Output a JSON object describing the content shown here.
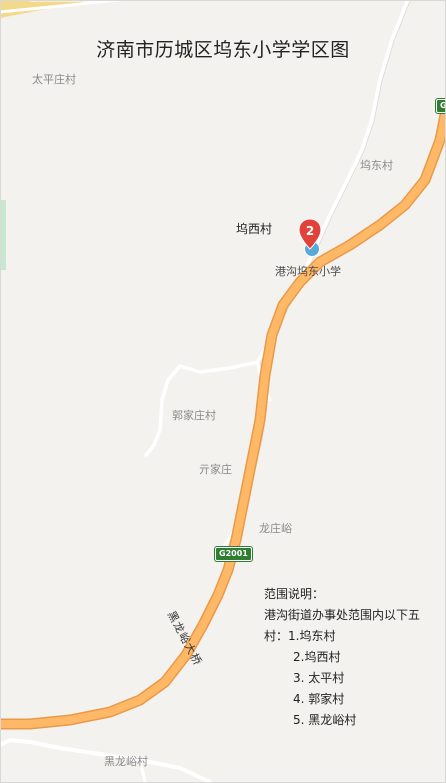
{
  "title": "济南市历城区坞东小学学区图",
  "places": {
    "taiping": "太平庄村",
    "wudong": "坞东村",
    "wuxi": "坞西村",
    "guojia": "郭家庄村",
    "kaijia": "亓家庄",
    "longzhuang": "龙庄峪",
    "heilongyu": "黑龙峪村"
  },
  "school": {
    "label": "港沟坞东小学",
    "marker_number": "2"
  },
  "roads": {
    "highway_top": "G",
    "highway_mid": "G2001",
    "bridge": "黑龙峪大桥"
  },
  "legend": {
    "heading": "范围说明：",
    "line1": "港沟街道办事处范围内以下五",
    "line2": "村：1.坞东村",
    "items": [
      "2.坞西村",
      "3. 太平村",
      "4. 郭家村",
      "5. 黑龙峪村"
    ]
  },
  "colors": {
    "highway": "#ffb866",
    "highway_edge": "#e89a4a",
    "marker": "#e2413a",
    "school_icon": "#5aa9d6"
  }
}
